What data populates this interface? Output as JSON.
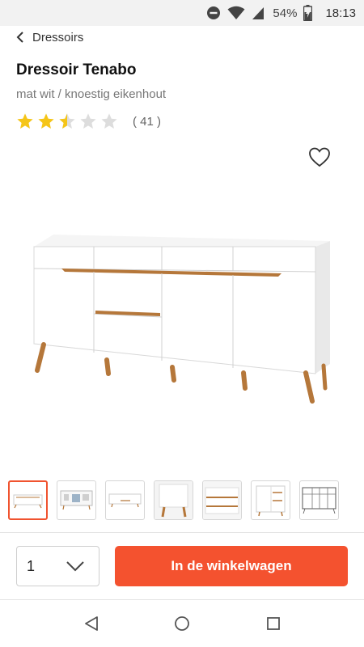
{
  "status_bar": {
    "battery_percent": "54%",
    "time": "18:13",
    "icons": [
      "do-not-disturb-icon",
      "wifi-icon",
      "signal-icon",
      "battery-charging-icon"
    ]
  },
  "header": {
    "back_label": "Dressoirs"
  },
  "product": {
    "title": "Dressoir Tenabo",
    "subtitle": "mat wit / knoestig eikenhout",
    "rating": 2.5,
    "rating_max": 5,
    "review_count": "( 41 )",
    "colors": {
      "star_filled": "#f5c518",
      "star_empty": "#dddddd",
      "cabinet": "#ffffff",
      "oak": "#b5773a"
    }
  },
  "gallery": {
    "thumbnail_count": 7,
    "active_index": 0
  },
  "purchase": {
    "quantity": "1",
    "cart_label": "In de winkelwagen",
    "accent_color": "#f4522f"
  },
  "system_nav": {
    "icons": [
      "back-triangle-icon",
      "home-circle-icon",
      "recents-square-icon"
    ]
  }
}
